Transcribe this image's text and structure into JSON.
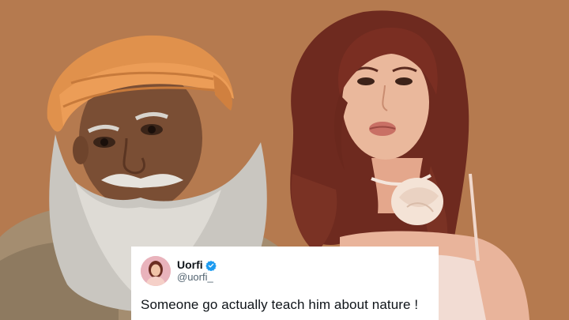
{
  "tweet": {
    "display_name": "Uorfi",
    "handle": "@uorfi_",
    "text": "Someone go actually teach him about nature !",
    "verified": true
  },
  "icons": {
    "verified": "verified-badge-icon"
  },
  "colors": {
    "background": "#b57a4f",
    "card": "#ffffff",
    "verified": "#1d9bf0",
    "text": "#0f1419",
    "muted": "#536471"
  }
}
